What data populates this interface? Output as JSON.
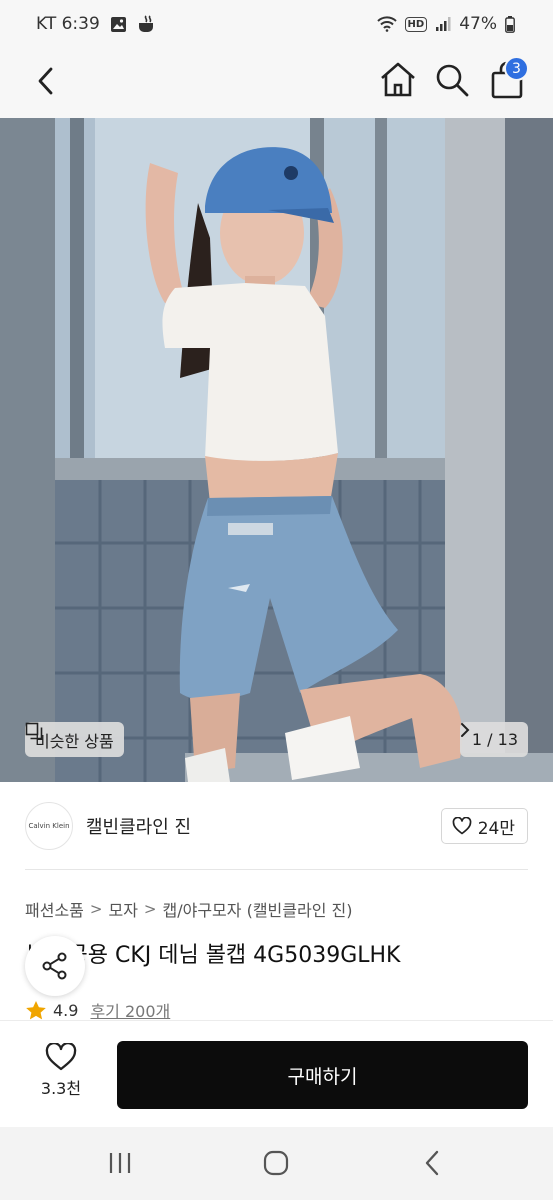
{
  "status_bar": {
    "carrier_time": "KT 6:39",
    "hd": "HD",
    "battery": "47%"
  },
  "header": {
    "cart_count": "3"
  },
  "hero": {
    "similar_label": "비슷한 상품",
    "page_indicator": "1 / 13"
  },
  "brand": {
    "logo_text": "Calvin Klein",
    "name": "캘빈클라인 진",
    "likes": "24만"
  },
  "breadcrumb": [
    "패션소품",
    "모자",
    "캡/야구모자 (캘빈클라인 진)"
  ],
  "product": {
    "title": "남녀공용 CKJ 데님 볼캡 4G5039GLHK",
    "rating": "4.9",
    "reviews": "후기 200개"
  },
  "bottom": {
    "wish_count": "3.3천",
    "buy_label": "구매하기"
  },
  "icons": {
    "back": "chevron-left-icon",
    "home": "home-icon",
    "search": "search-icon",
    "bag": "shopping-bag-icon",
    "share": "share-icon",
    "heart": "heart-icon",
    "star": "star-icon"
  },
  "colors": {
    "badge": "#2f6fe0",
    "buy_button": "#0c0c0c",
    "star": "#f0a500"
  }
}
